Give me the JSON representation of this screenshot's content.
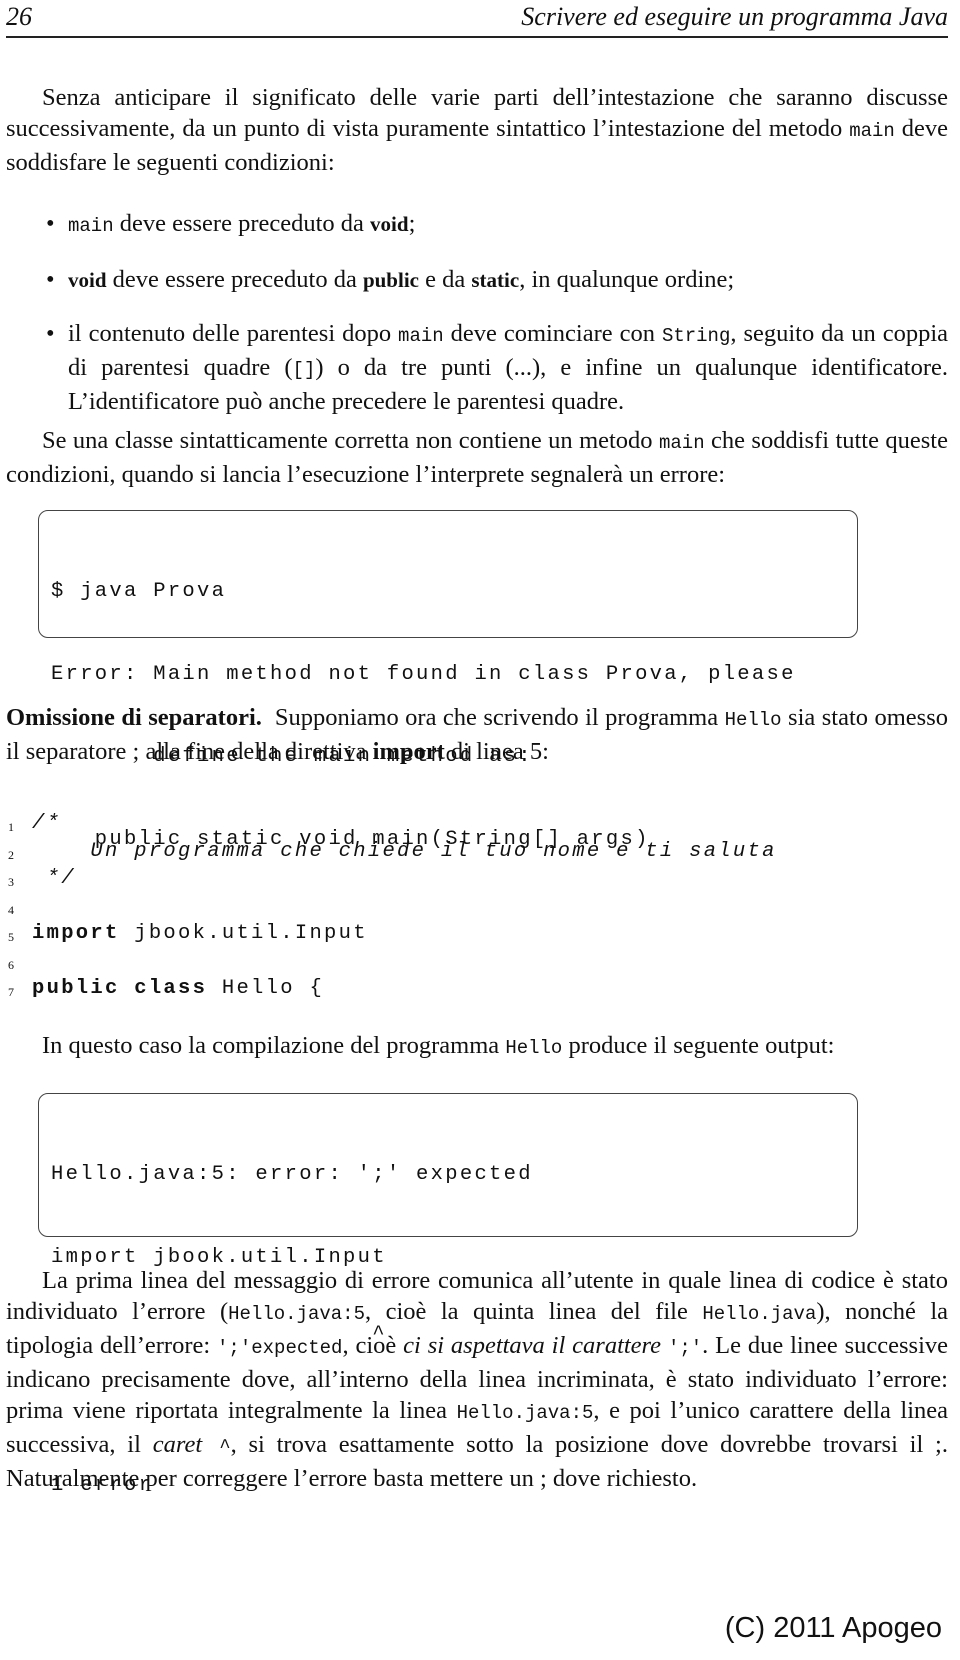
{
  "header": {
    "page_number": "26",
    "running_title": "Scrivere ed eseguire un programma Java"
  },
  "intro": {
    "text_before": "Senza anticipare il significato delle varie parti dell’intestazione che saranno discusse successivamente, da un punto di vista puramente sintattico l’intestazione del metodo ",
    "code": "main",
    "text_after": " deve soddisfare le seguenti condizioni:"
  },
  "bullets": [
    {
      "c1": "main",
      "t1": " deve essere preceduto da ",
      "k1": "void",
      "t2": ";"
    },
    {
      "k1": "void",
      "t1": " deve essere preceduto da ",
      "k2": "public",
      "t2": " e da ",
      "k3": "static",
      "t3": ", in qualunque ordine;"
    },
    {
      "t1": "il contenuto delle parentesi dopo ",
      "c1": "main",
      "t2": " deve cominciare con ",
      "c2": "String",
      "t3": ", seguito da un coppia di parentesi quadre (",
      "c3": "[]",
      "t4": ") o da tre punti (...), e infine un qualunque identificatore. L’identificatore può anche precedere le parentesi quadre."
    }
  ],
  "para2": {
    "t1": "Se una classe sintatticamente corretta non contiene un metodo ",
    "c1": "main",
    "t2": " che soddisfi tutte queste condizioni, quando si lancia l’esecuzione l’interprete segnalerà un errore:"
  },
  "terminal1": {
    "lines": [
      "$ java Prova",
      "Error: Main method not found in class Prova, please",
      "       define the main method as:",
      "   public static void main(String[] args)"
    ]
  },
  "section": {
    "title": "Omissione di separatori.",
    "t1": "  Supponiamo ora che scrivendo il programma ",
    "c1": "Hello",
    "t2": " sia stato omesso il separatore ; alla fine della direttiva ",
    "k1": "import",
    "t3": " di linea 5:"
  },
  "listing": [
    {
      "num": "1",
      "code": "/*",
      "style": "cm"
    },
    {
      "num": "2",
      "code": "    Un programma che chiede il tuo nome e ti saluta",
      "style": "cm"
    },
    {
      "num": "3",
      "code": " */",
      "style": "cm"
    },
    {
      "num": "4",
      "code": "",
      "style": ""
    },
    {
      "num": "5",
      "kw": "import",
      "code": " jbook.util.Input",
      "style": ""
    },
    {
      "num": "6",
      "code": "",
      "style": ""
    },
    {
      "num": "7",
      "kw": "public class",
      "code": " Hello {",
      "style": ""
    }
  ],
  "para3": {
    "t1": "In questo caso la compilazione del programma ",
    "c1": "Hello",
    "t2": " produce il seguente output:"
  },
  "terminal2": {
    "lines": [
      "Hello.java:5: error: ';' expected",
      "import jbook.util.Input",
      "                      ^",
      "",
      "1 error"
    ]
  },
  "para4": {
    "t1": "La prima linea del messaggio di errore comunica all’utente in quale linea di codice è stato individuato l’errore (",
    "c1": "Hello.java:5",
    "t2": ", cioè la quinta linea del file ",
    "c2": "Hello.java",
    "t3": "), nonché la tipologia dell’errore: ",
    "c3": "';'expected",
    "t4": ", cioè ",
    "i1": "ci si aspettava il carattere ",
    "c4": "';'",
    "t5": ". Le due linee successive indicano precisamente dove, all’interno della linea incriminata, è stato individuato l’errore: prima viene riportata integralmente la linea ",
    "c5": "Hello.java:5",
    "t6": ", e poi l’unico carattere della linea successiva, il ",
    "i2": "caret",
    "c6": " ^",
    "t7": ", si trova esattamente sotto la posizione dove dovrebbe trovarsi il ;.  Naturalmente per correggere l’errore basta mettere un ; dove richiesto."
  },
  "footer": {
    "copyright": "(C) 2011 Apogeo"
  }
}
